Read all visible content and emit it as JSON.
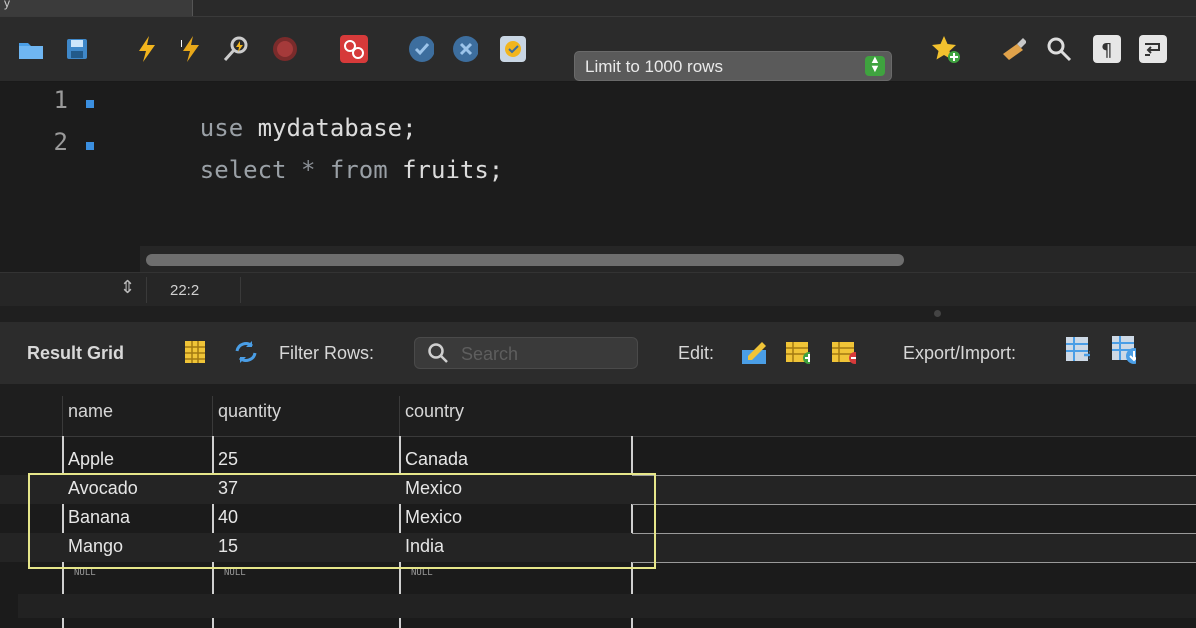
{
  "tab": {
    "title": "y"
  },
  "toolbar": {
    "icons": [
      "open-folder-icon",
      "save-icon",
      "execute-icon",
      "execute-current-icon",
      "explain-icon",
      "stop-icon",
      "toggle-error-icon",
      "commit-icon",
      "rollback-icon",
      "autocommit-icon",
      "bookmark-star-icon",
      "beautify-icon",
      "find-icon",
      "invisible-chars-icon",
      "wrap-icon"
    ],
    "limit_label": "Limit to 1000 rows"
  },
  "editor": {
    "lines": [
      {
        "num": "1",
        "kw": "use",
        "rest": " mydatabase;"
      },
      {
        "num": "2",
        "kw": "select",
        "op": " * ",
        "kw2": "from",
        "rest": " fruits;"
      }
    ]
  },
  "status": {
    "cursor": "22:2"
  },
  "results": {
    "title": "Result Grid",
    "filter_label": "Filter Rows:",
    "search_placeholder": "Search",
    "edit_label": "Edit:",
    "export_label": "Export/Import:",
    "columns": [
      "name",
      "quantity",
      "country"
    ],
    "rows": [
      [
        "Apple",
        "25",
        "Canada"
      ],
      [
        "Avocado",
        "37",
        "Mexico"
      ],
      [
        "Banana",
        "40",
        "Mexico"
      ],
      [
        "Mango",
        "15",
        "India"
      ]
    ],
    "null_text": "NULL"
  },
  "colors": {
    "accent": "#3b8fe0",
    "highlight": "#e6e68a",
    "limit_stepper": "#3fa33f"
  }
}
